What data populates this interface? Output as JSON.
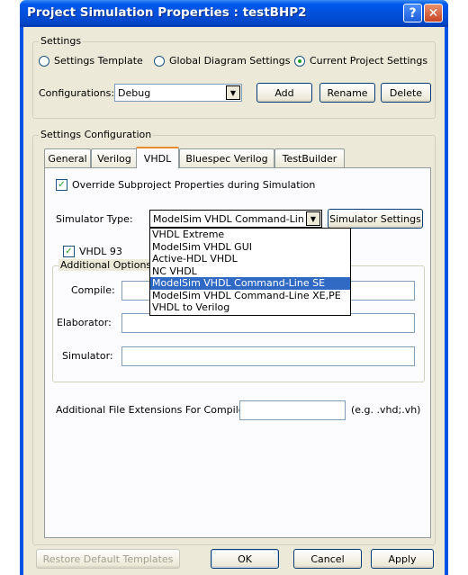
{
  "window": {
    "title": "Project Simulation Properties : testBHP2"
  },
  "settings": {
    "legend": "Settings",
    "radios": [
      {
        "label": "Settings Template",
        "selected": false
      },
      {
        "label": "Global Diagram Settings",
        "selected": false
      },
      {
        "label": "Current Project Settings",
        "selected": true
      }
    ],
    "configurations_label": "Configurations:",
    "configuration_value": "Debug",
    "add_label": "Add",
    "rename_label": "Rename",
    "delete_label": "Delete"
  },
  "settings_configuration": {
    "legend": "Settings Configuration",
    "tabs": [
      "General",
      "Verilog",
      "VHDL",
      "Bluespec Verilog",
      "TestBuilder"
    ],
    "active_tab": "VHDL",
    "override_label": "Override Subproject Properties during Simulation",
    "override_checked": true,
    "simulator_type_label": "Simulator Type:",
    "simulator_type_value": "ModelSim VHDL Command-Line SE",
    "simulator_settings_label": "Simulator Settings",
    "vhdl93_label": "VHDL 93",
    "vhdl93_checked": true,
    "additional_options_legend": "Additional Options",
    "compile_label": "Compile:",
    "elaborator_label": "Elaborator:",
    "simulator_label": "Simulator:",
    "compile_value": "",
    "elaborator_value": "",
    "simulator_value": "",
    "extensions_label": "Additional File Extensions For Compile:",
    "extensions_value": "",
    "extensions_hint": "(e.g. .vhd;.vh)",
    "dropdown_options": [
      "VHDL Extreme",
      "ModelSim VHDL GUI",
      "Active-HDL VHDL",
      "NC VHDL",
      "ModelSim VHDL Command-Line SE",
      "ModelSim VHDL Command-Line XE,PE",
      "VHDL to Verilog"
    ],
    "dropdown_selected_index": 4
  },
  "footer": {
    "restore_label": "Restore Default Templates",
    "ok_label": "OK",
    "cancel_label": "Cancel",
    "apply_label": "Apply"
  },
  "colors": {
    "titlebar": "#0053e6",
    "dialog_bg": "#ece9d8",
    "selection": "#316ac5",
    "tab_highlight": "#e68b2c"
  }
}
